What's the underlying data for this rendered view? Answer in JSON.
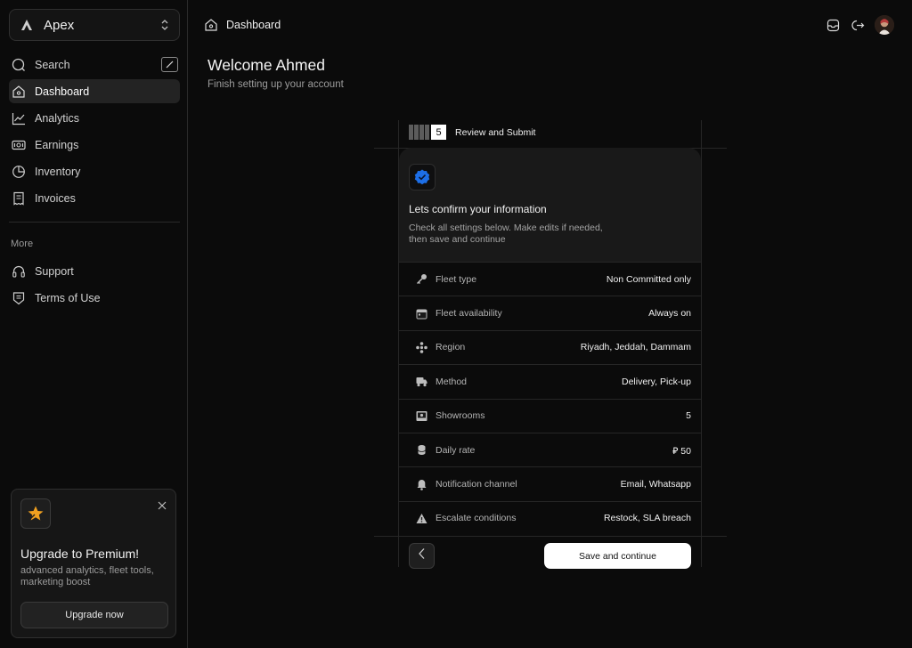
{
  "org": {
    "name": "Apex",
    "logo_icon": "triangle-logo-icon",
    "switch_icon": "chevron-updown-icon"
  },
  "sidebar": {
    "items": [
      {
        "label": "Search",
        "icon": "search-icon"
      },
      {
        "label": "Dashboard",
        "icon": "home-icon",
        "active": true
      },
      {
        "label": "Analytics",
        "icon": "chart-line-icon"
      },
      {
        "label": "Earnings",
        "icon": "banknote-icon"
      },
      {
        "label": "Inventory",
        "icon": "pie-chart-icon"
      },
      {
        "label": "Invoices",
        "icon": "receipt-icon"
      }
    ],
    "more_label": "More",
    "more_items": [
      {
        "label": "Support",
        "icon": "headset-icon"
      },
      {
        "label": "Terms of Use",
        "icon": "shield-doc-icon"
      }
    ]
  },
  "promo": {
    "title": "Upgrade to Premium!",
    "subtitle": "advanced analytics, fleet tools, marketing boost",
    "button": "Upgrade now",
    "icon": "star-icon"
  },
  "header": {
    "breadcrumb": "Dashboard",
    "icons": [
      "inbox-icon",
      "logout-icon",
      "avatar"
    ]
  },
  "welcome": {
    "title": "Welcome Ahmed",
    "subtitle": "Finish setting up your account"
  },
  "wizard": {
    "step_number": "5",
    "step_title": "Review and Submit",
    "card_title": "Lets confirm your information",
    "card_desc": "Check all settings below. Make edits if needed, then save and continue",
    "rows": [
      {
        "label": "Fleet type",
        "value": "Non Committed only",
        "icon": "key-icon"
      },
      {
        "label": "Fleet availability",
        "value": "Always on",
        "icon": "calendar-icon"
      },
      {
        "label": "Region",
        "value": "Riyadh, Jeddah, Dammam",
        "icon": "region-icon"
      },
      {
        "label": "Method",
        "value": "Delivery, Pick-up",
        "icon": "truck-icon"
      },
      {
        "label": "Showrooms",
        "value": "5",
        "icon": "showroom-icon"
      },
      {
        "label": "Daily rate",
        "value": "⃁ 50",
        "icon": "coins-icon"
      },
      {
        "label": "Notification channel",
        "value": "Email, Whatsapp",
        "icon": "bell-icon"
      },
      {
        "label": "Escalate conditions",
        "value": "Restock, SLA breach",
        "icon": "warning-icon"
      }
    ],
    "save_label": "Save and continue"
  },
  "colors": {
    "background": "#0b0b0b",
    "surface": "#191919",
    "accent": "#1d6fe8",
    "promo_star": "#f0a020"
  }
}
